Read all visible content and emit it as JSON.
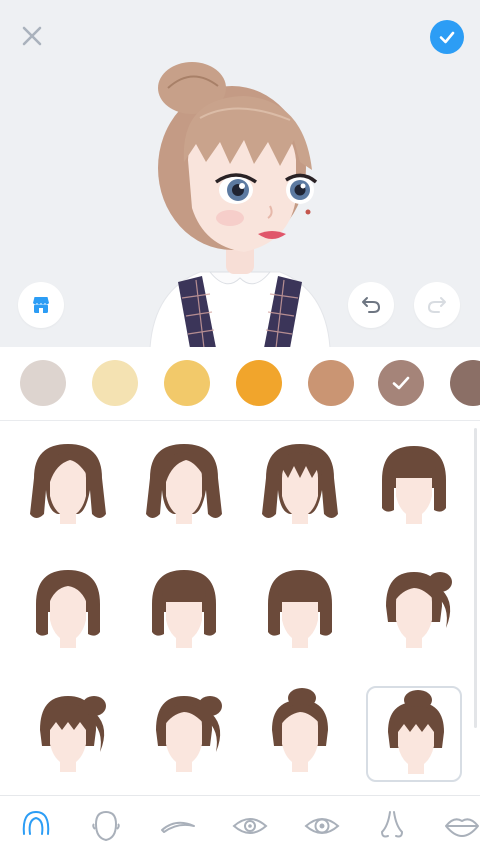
{
  "toolbar": {
    "close_icon": "close-icon",
    "confirm_icon": "check-icon",
    "shop_icon": "store-icon",
    "undo_icon": "undo-icon",
    "redo_icon": "redo-icon"
  },
  "colors": {
    "swatches": [
      "#ddd4cf",
      "#f4e2b2",
      "#f2c96a",
      "#f1a52c",
      "#ca9573",
      "#a58479",
      "#8b6f66"
    ],
    "selected_index": 5
  },
  "hair_grid": {
    "hair_color": "#6b4a3a",
    "skin_color": "#fae6de",
    "selected_index": 11,
    "styles": [
      "wavy-side-part",
      "wavy-swept",
      "wavy-bangs",
      "bob-bangs",
      "bob-center-part",
      "bob-blunt-bangs",
      "bob-rounded-bangs",
      "side-ponytail",
      "ponytail-bangs",
      "ponytail-swept",
      "high-bun",
      "bun-bangs"
    ]
  },
  "bottom_nav": {
    "active_index": 0,
    "accent": "#2c9df5",
    "items": [
      "hair-icon",
      "face-shape-icon",
      "eyebrow-icon",
      "eye-icon",
      "eye-color-icon",
      "nose-icon",
      "lips-icon"
    ]
  }
}
